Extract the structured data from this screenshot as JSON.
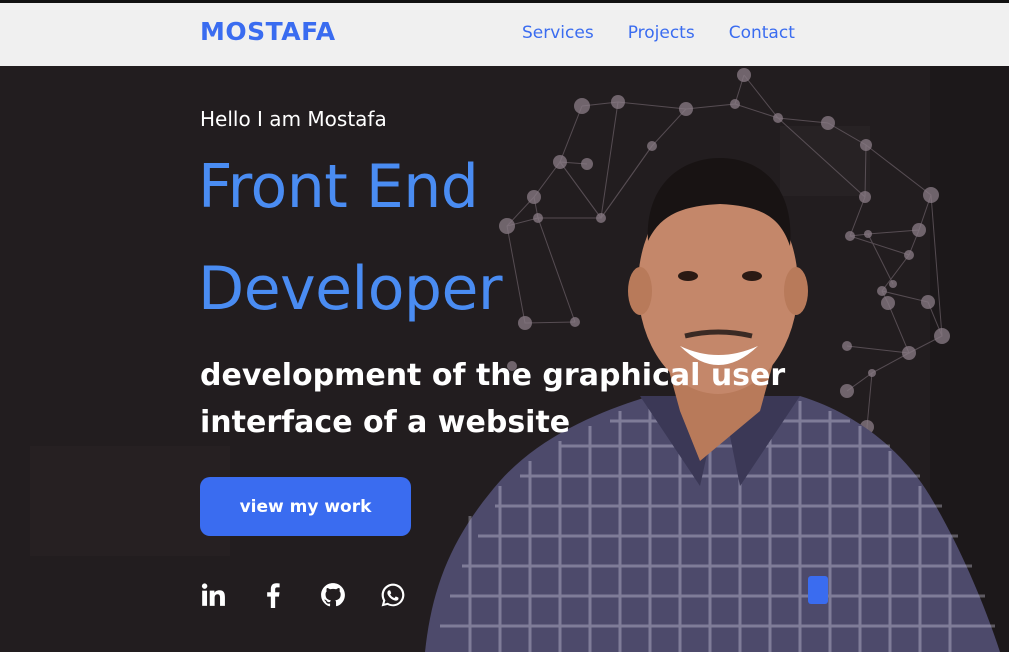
{
  "brand": {
    "name": "MOSTAFA"
  },
  "nav": {
    "links": [
      "Services",
      "Projects",
      "Contact"
    ]
  },
  "hero": {
    "greeting": "Hello I am Mostafa",
    "title_line1": "Front End",
    "title_line2": "Developer",
    "subtitle": "development of the graphical user interface of a website",
    "cta_label": "view my work"
  },
  "social": {
    "icons": [
      "linkedin-icon",
      "facebook-icon",
      "github-icon",
      "whatsapp-icon"
    ]
  },
  "colors": {
    "accent": "#3a6cf0",
    "title": "#4a8cf2",
    "hero_bg": "#221d1f",
    "navbar_bg": "#f0f0f0"
  }
}
